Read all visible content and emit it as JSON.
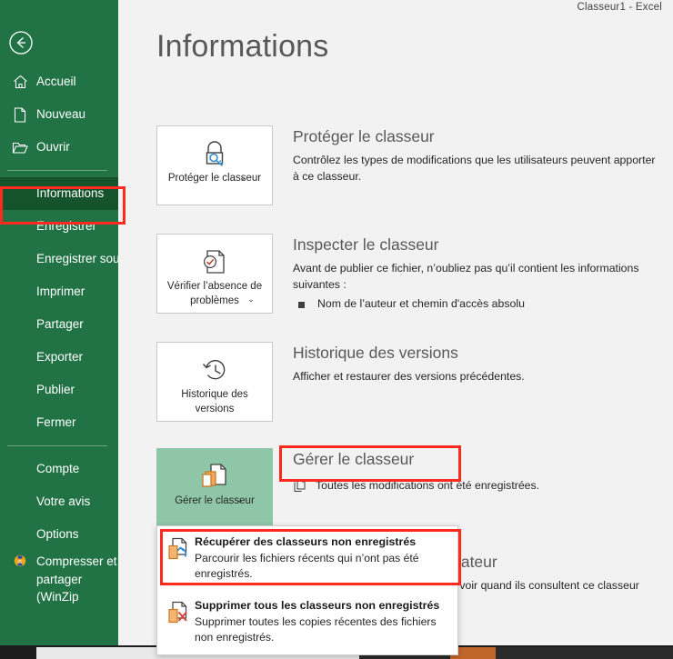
{
  "window": {
    "doc_title": "Classeur1  -  Excel",
    "accent_green": "#217346",
    "active_green": "#14532b",
    "highlight_red": "#ff2a1f",
    "selected_tile_green": "#8fc6a8"
  },
  "backstage": {
    "back_button": "back-arrow",
    "page_title": "Informations"
  },
  "sidebar": {
    "items": [
      {
        "label": "Accueil",
        "icon": "home-icon",
        "active": false,
        "separator_after": false
      },
      {
        "label": "Nouveau",
        "icon": "page-icon",
        "active": false,
        "separator_after": false
      },
      {
        "label": "Ouvrir",
        "icon": "folder-icon",
        "active": false,
        "separator_after": true
      },
      {
        "label": "Informations",
        "icon": "",
        "active": true,
        "separator_after": false
      },
      {
        "label": "Enregistrer",
        "icon": "",
        "active": false,
        "separator_after": false
      },
      {
        "label": "Enregistrer sous",
        "icon": "",
        "active": false,
        "separator_after": false
      },
      {
        "label": "Imprimer",
        "icon": "",
        "active": false,
        "separator_after": false
      },
      {
        "label": "Partager",
        "icon": "",
        "active": false,
        "separator_after": false
      },
      {
        "label": "Exporter",
        "icon": "",
        "active": false,
        "separator_after": false
      },
      {
        "label": "Publier",
        "icon": "",
        "active": false,
        "separator_after": false
      },
      {
        "label": "Fermer",
        "icon": "",
        "active": false,
        "separator_after": true
      },
      {
        "label": "Compte",
        "icon": "",
        "active": false,
        "separator_after": false
      },
      {
        "label": "Votre avis",
        "icon": "",
        "active": false,
        "separator_after": false
      },
      {
        "label": "Options",
        "icon": "",
        "active": false,
        "separator_after": false
      }
    ],
    "winzip": {
      "label": "Compresser et partager (WinZip",
      "icon": "winzip-icon"
    }
  },
  "sections": {
    "protect": {
      "button_label": "Protéger le classeur",
      "button_icon": "lock-key-icon",
      "has_chevron": true,
      "heading": "Protéger le classeur",
      "description": "Contrôlez les types de modifications que les utilisateurs peuvent apporter à ce classeur."
    },
    "inspect": {
      "button_label": "Vérifier l’absence de problèmes",
      "button_icon": "document-check-icon",
      "has_chevron": true,
      "heading": "Inspecter le classeur",
      "description": "Avant de publier ce fichier, n’oubliez pas qu’il contient les informations suivantes :",
      "bullets": [
        "Nom de l’auteur et chemin d'accès absolu"
      ]
    },
    "history": {
      "button_label": "Historique des versions",
      "button_icon": "clock-back-icon",
      "has_chevron": false,
      "heading": "Historique des versions",
      "description": "Afficher et restaurer des versions précédentes."
    },
    "manage": {
      "button_label": "Gérer le classeur",
      "button_icon": "copy-documents-icon",
      "has_chevron": true,
      "heading": "Gérer le classeur",
      "status_icon": "copy-small-icon",
      "status_text": "Toutes les modifications ont été enregistrées."
    },
    "browser": {
      "heading_visible": "navigateur",
      "description_visible": "euvent voir quand ils consultent ce classeur"
    }
  },
  "dropdown": {
    "items": [
      {
        "title": "Récupérer des classeurs non enregistrés",
        "subtitle": "Parcourir les fichiers récents qui n’ont pas été enregistrés.",
        "icon": "recover-documents-icon",
        "highlighted": true
      },
      {
        "title": "Supprimer tous les classeurs non enregistrés",
        "subtitle": "Supprimer toutes les copies récentes des fichiers non enregistrés.",
        "icon": "delete-documents-icon",
        "highlighted": false
      }
    ]
  }
}
